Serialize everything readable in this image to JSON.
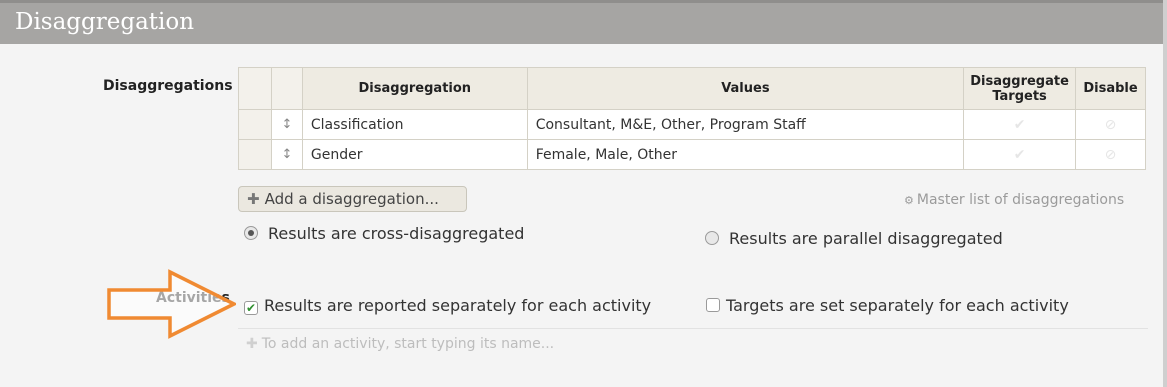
{
  "header": {
    "title": "Disaggregation"
  },
  "disaggregations": {
    "label": "Disaggregations",
    "columns": {
      "disaggregation": "Disaggregation",
      "values": "Values",
      "disaggregate_targets": "Disaggregate Targets",
      "disable": "Disable"
    },
    "rows": [
      {
        "handle": "↕",
        "name": "Classification",
        "values": "Consultant, M&E, Other, Program Staff"
      },
      {
        "handle": "↕",
        "name": "Gender",
        "values": "Female, Male, Other"
      }
    ],
    "add_button": "Add a disaggregation...",
    "master_list_link": "Master list of disaggregations",
    "radio_cross": "Results are cross-disaggregated",
    "radio_parallel": "Results are parallel disaggregated",
    "selected_mode": "cross"
  },
  "activities": {
    "label": "Activities",
    "reported_separately": "Results are reported separately for each activity",
    "reported_separately_checked": true,
    "targets_separately": "Targets are set separately for each activity",
    "targets_separately_checked": false,
    "add_placeholder": "To add an activity, start typing its name..."
  },
  "colors": {
    "header_bg": "#a6a5a3",
    "arrow": "#f08a32",
    "check_green": "#2f8f2f"
  }
}
